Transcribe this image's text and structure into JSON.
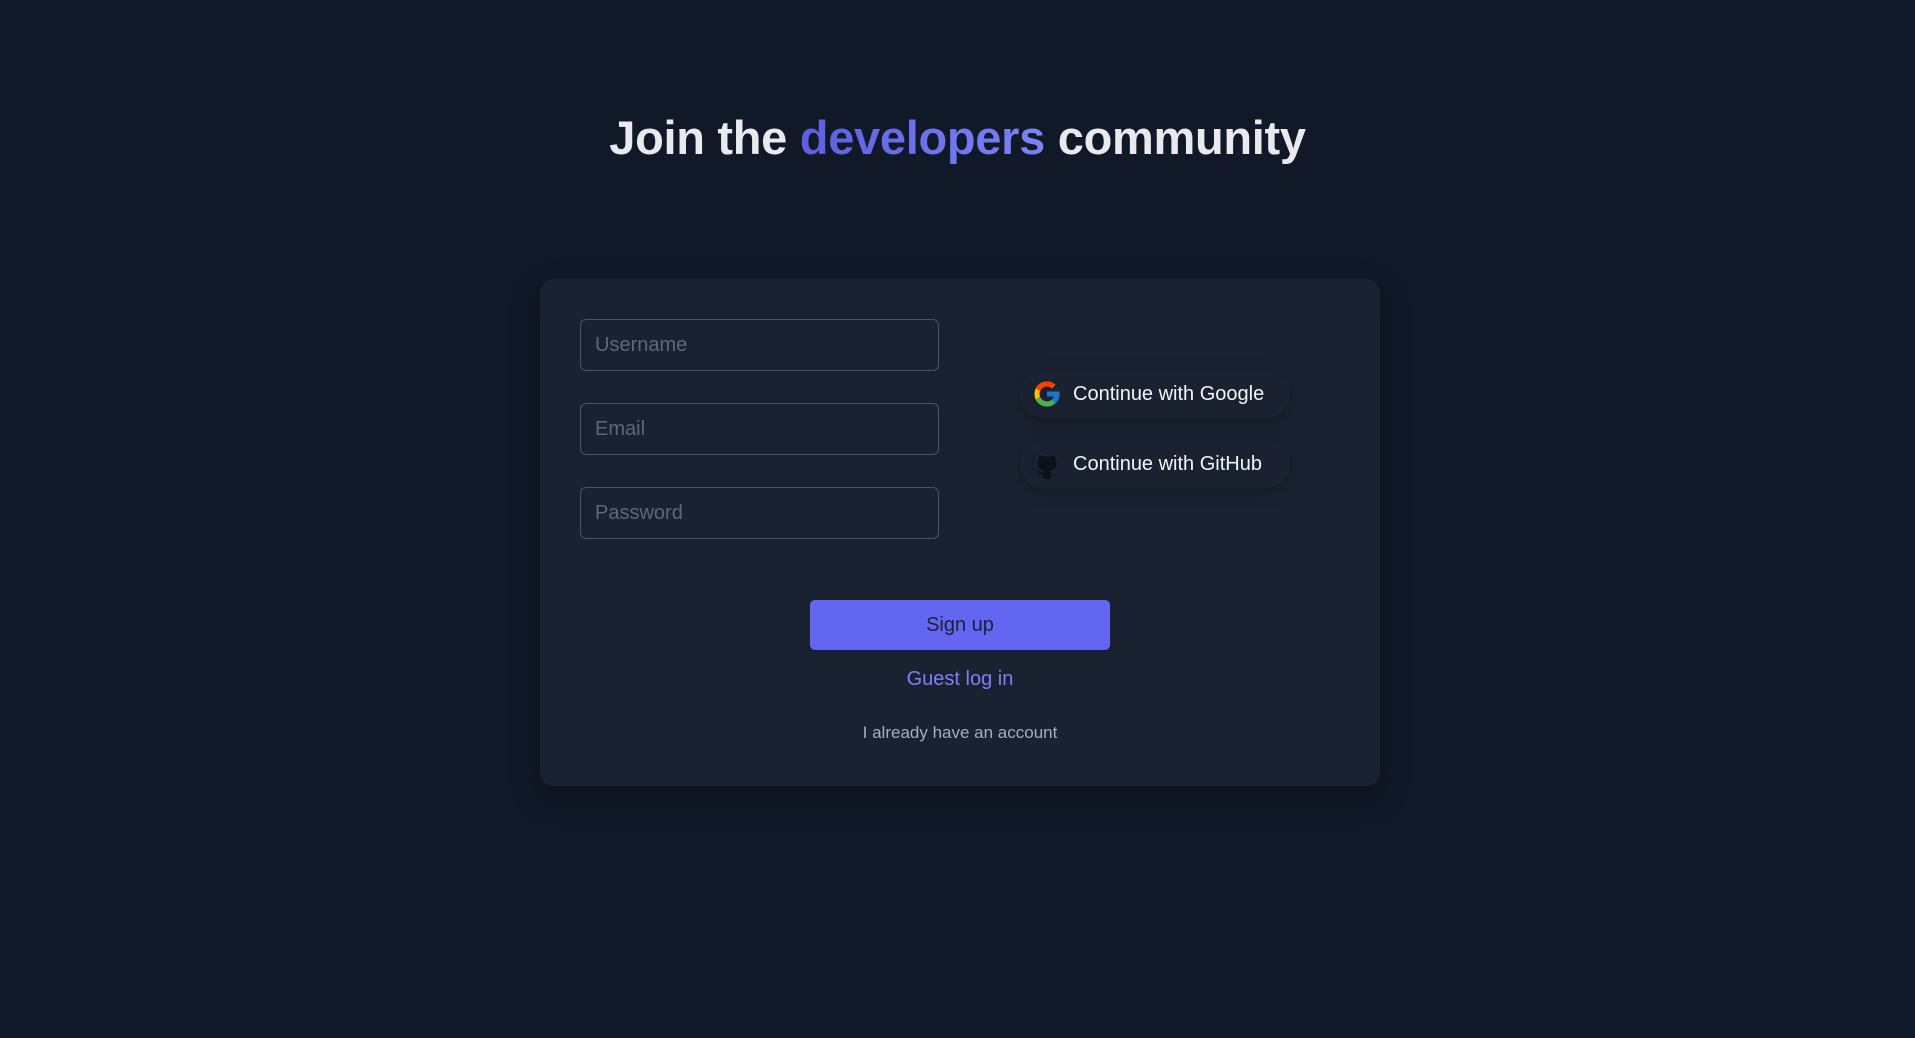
{
  "hero": {
    "title_prefix": "Join the ",
    "title_accent": "developers",
    "title_suffix": " community"
  },
  "form": {
    "username_placeholder": "Username",
    "email_placeholder": "Email",
    "password_placeholder": "Password",
    "signup_label": "Sign up",
    "guest_label": "Guest log in",
    "account_label": "I already have an account"
  },
  "oauth": {
    "google_label": "Continue with Google",
    "github_label": "Continue with GitHub",
    "google_icon": "google-icon",
    "github_icon": "github-icon"
  },
  "colors": {
    "background": "#111827",
    "card": "#1a2231",
    "accent": "#6366f1",
    "link": "#7b80f5"
  }
}
